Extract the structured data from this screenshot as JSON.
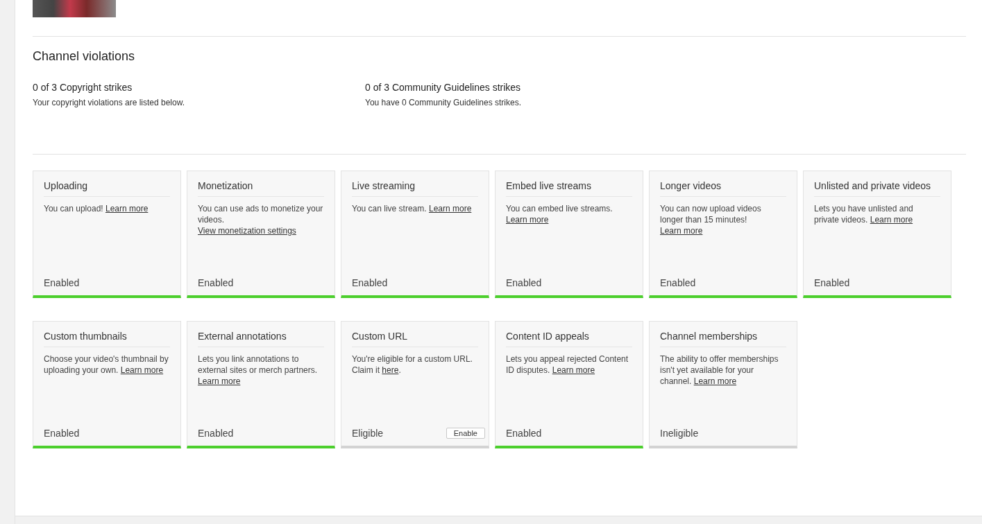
{
  "section": {
    "title": "Channel violations"
  },
  "strikes": [
    {
      "title": "0 of 3 Copyright strikes",
      "description": "Your copyright violations are listed below."
    },
    {
      "title": "0 of 3 Community Guidelines strikes",
      "description": "You have 0 Community Guidelines strikes."
    }
  ],
  "features": [
    {
      "title": "Uploading",
      "text": "You can upload! ",
      "link": "Learn more",
      "status": "Enabled",
      "enabled": true
    },
    {
      "title": "Monetization",
      "text": "You can use ads to monetize your videos. ",
      "link": "View monetization settings",
      "status": "Enabled",
      "enabled": true
    },
    {
      "title": "Live streaming",
      "text": "You can live stream. ",
      "link": "Learn more",
      "status": "Enabled",
      "enabled": true
    },
    {
      "title": "Embed live streams",
      "text": "You can embed live streams. ",
      "link": "Learn more",
      "status": "Enabled",
      "enabled": true
    },
    {
      "title": "Longer videos",
      "text": "You can now upload videos longer than 15 minutes! ",
      "link": "Learn more",
      "status": "Enabled",
      "enabled": true
    },
    {
      "title": "Unlisted and private videos",
      "text": "Lets you have unlisted and private videos. ",
      "link": "Learn more",
      "status": "Enabled",
      "enabled": true
    },
    {
      "title": "Custom thumbnails",
      "text": "Choose your video's thumbnail by uploading your own. ",
      "link": "Learn more",
      "status": "Enabled",
      "enabled": true
    },
    {
      "title": "External annotations",
      "text": "Lets you link annotations to external sites or merch partners. ",
      "link": "Learn more",
      "status": "Enabled",
      "enabled": true
    },
    {
      "title": "Custom URL",
      "text": "You're eligible for a custom URL. Claim it ",
      "link": "here",
      "after": ".",
      "status": "Eligible",
      "enabled": false,
      "button": "Enable"
    },
    {
      "title": "Content ID appeals",
      "text": "Lets you appeal rejected Content ID disputes. ",
      "link": "Learn more",
      "status": "Enabled",
      "enabled": true
    },
    {
      "title": "Channel memberships",
      "text": "The ability to offer memberships isn't yet available for your channel. ",
      "link": "Learn more",
      "status": "Ineligible",
      "enabled": false
    }
  ]
}
